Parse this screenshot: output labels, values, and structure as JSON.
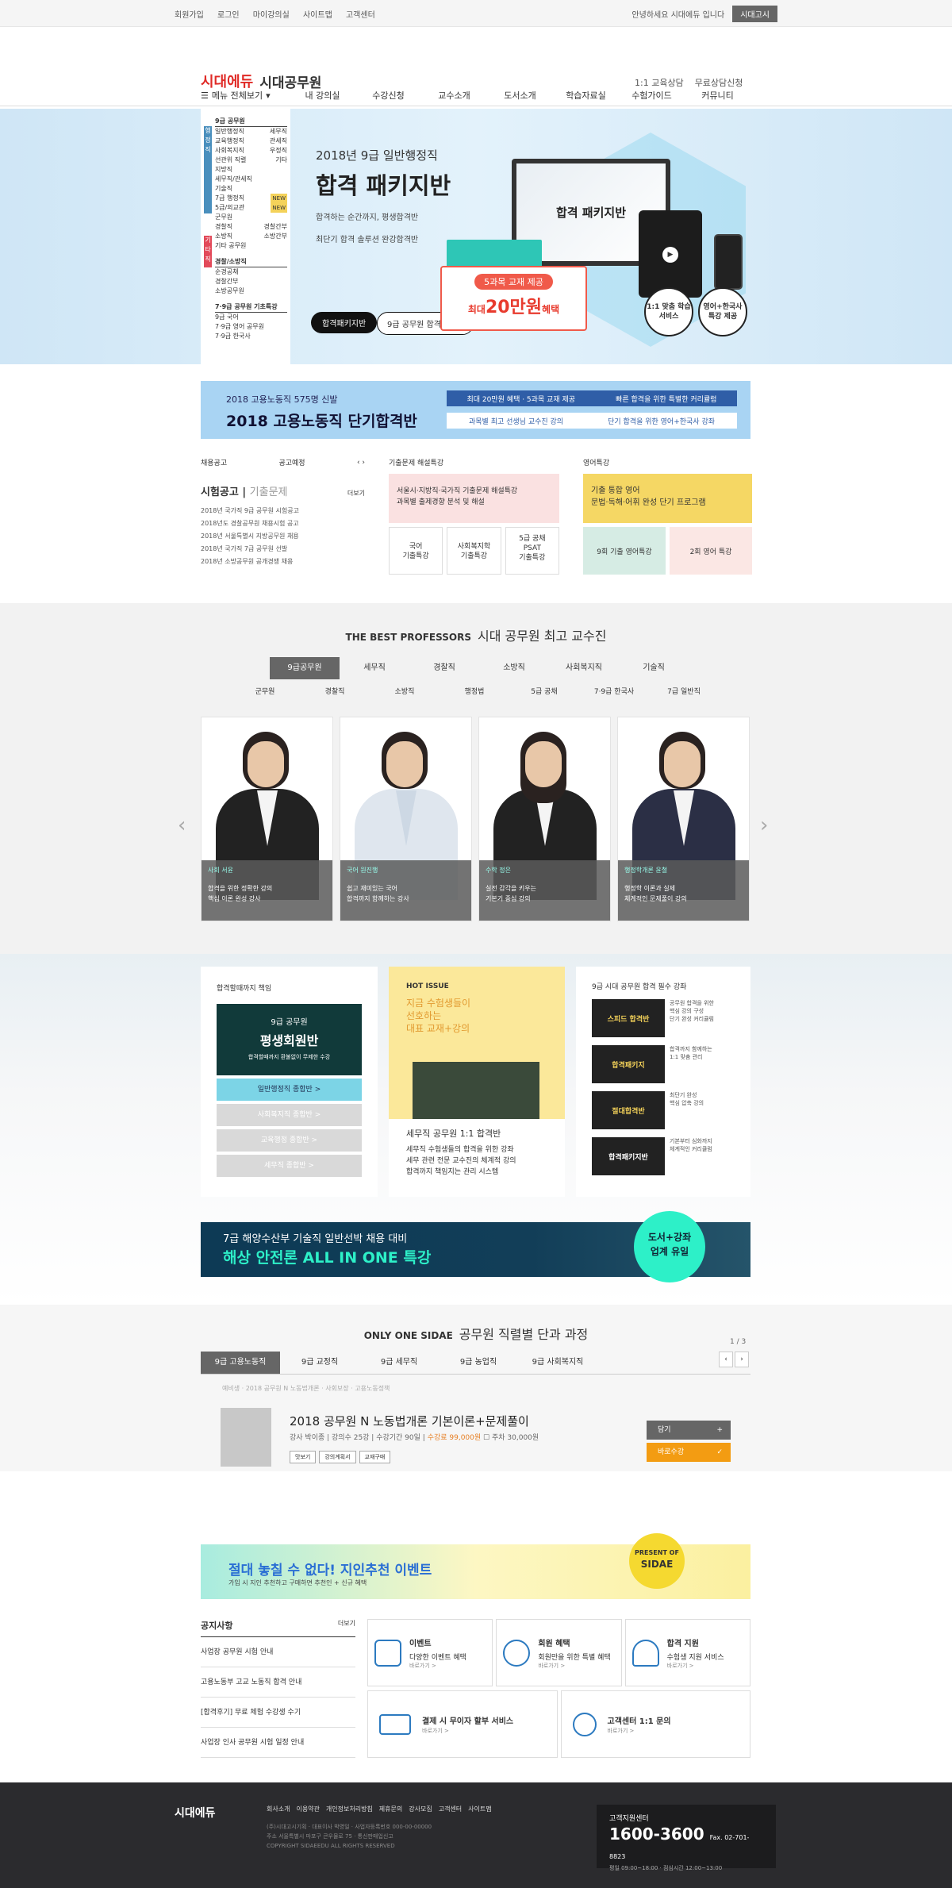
{
  "topbar": {
    "links": [
      "회원가입",
      "로그인",
      "마이강의실",
      "사이트맵",
      "고객센터"
    ],
    "greeting": "안녕하세요 시대에듀 입니다",
    "btn": "시대고시"
  },
  "header": {
    "brand": "시대에듀",
    "site": "시대공무원",
    "r1": "1:1 교육상담",
    "r2": "무료상담신청"
  },
  "gnb": {
    "all": "메뉴 전체보기",
    "items": [
      "내 강의실",
      "수강신청",
      "교수소개",
      "도서소개",
      "학습자료실",
      "수험가이드",
      "커뮤니티"
    ]
  },
  "side": {
    "g1": "9급 공무원",
    "items1": [
      [
        "일반행정직",
        "세무직"
      ],
      [
        "교육행정직",
        "관세직"
      ],
      [
        "사회복지직",
        "우정직"
      ],
      [
        "선관위 직렬",
        "기타"
      ],
      [
        "지방직",
        ""
      ],
      [
        "세무직/관세직",
        ""
      ],
      [
        "기술직",
        ""
      ],
      [
        "7급 행정직",
        "NEW"
      ],
      [
        "5급/외교관",
        "NEW"
      ],
      [
        "군무원",
        ""
      ],
      [
        "경찰직",
        "경찰간부"
      ],
      [
        "소방직",
        "소방간부"
      ],
      [
        "기타 공무원",
        ""
      ]
    ],
    "tab1": "행정직",
    "tab2": "기타직",
    "g2": "경찰/소방직",
    "items2": [
      "순경공채",
      "경찰간부",
      "소방공무원"
    ],
    "g3": "7·9급 공무원 기초특강",
    "items3": [
      "9급 국어",
      "7·9급 영어 공무원",
      "7·9급 한국사"
    ]
  },
  "hero": {
    "sub": "2018년 9급 일반행정직",
    "title": "합격 패키지반",
    "d1": "합격하는 순간까지, 평생합격반",
    "d2": "최단기 합격 솔루션 완강합격반",
    "btn1": "합격패키지반",
    "btn2": "9급 공무원 합격상담반",
    "screen": "합격 패키지반",
    "cp1": "5과목 교재 제공",
    "cp2": "최대",
    "cp3": "20만원",
    "cp4": "혜택",
    "c1": "1:1 맞춤\n학습서비스",
    "c2": "영어+한국사\n특강 제공"
  },
  "bnr2": {
    "l1": "2018 고용노동직 575명 신발",
    "l2": "2018 고용노동직 단기합격반",
    "r1a": "최대 20만원 혜택 · 5과목 교재 제공",
    "r1b": "빠른 합격을 위한 특별한 커리큘럼",
    "r2a": "과목별 최고 선생님 교수진 강의",
    "r2b": "단기 합격을 위한 영어+한국사 강좌"
  },
  "exam": {
    "t1": "채용공고",
    "t2": "공고예정",
    "title": "시험공고",
    "title2": "기출문제",
    "more": "더보기",
    "items": [
      "2018년 국가직 9급 공무원 시험공고",
      "2018년도 경찰공무원 채용시험 공고",
      "2018년 서울특별시 지방공무원 채용",
      "2018년 국가직 7급 공무원 선발",
      "2018년 소방공무원 공개경쟁 채용"
    ]
  },
  "spcA": {
    "hd": "기출문제 해설특강",
    "box": "서울시·지방직·국가직 기출문제 해설특강\n과목별 출제경향 분석 및 해설",
    "m": [
      "국어\n기출특강",
      "사회복지학\n기출특강",
      "5급 공채\nPSAT\n기출특강"
    ]
  },
  "spcB": {
    "hd": "영어특강",
    "box": "기출 통합 영어\n문법·독해·어휘 완성 단기 프로그램",
    "m": [
      "9회 기출 영어특강",
      "2회 영어 특강"
    ]
  },
  "prof": {
    "en": "THE BEST PROFESSORS",
    "ko": "시대 공무원 최고 교수진",
    "tabs": [
      "9급공무원",
      "세무직",
      "경찰직",
      "소방직",
      "사회복지직",
      "기술직"
    ],
    "tabs2": [
      "군무원",
      "경찰직",
      "소방직",
      "행정법",
      "5급 공채",
      "7·9급 한국사",
      "7급 일반직"
    ],
    "cards": [
      {
        "nm": "사회 서윤",
        "d": "합격을 위한 정확한 강의\n핵심 이론 완성 강사"
      },
      {
        "nm": "국어 원진행",
        "d": "쉽고 재미있는 국어\n합격까지 함께하는 강사"
      },
      {
        "nm": "수학 정은",
        "d": "실전 감각을 키우는\n기본기 중심 강의"
      },
      {
        "nm": "행정학개론 윤철",
        "d": "행정학 이론과 실제\n체계적인 문제풀이 강의"
      }
    ]
  },
  "s5": {
    "c1t": "합격할때까지 책임",
    "pv1": "9급 공무원",
    "pv2": "평생회원반",
    "pv3": "합격할때까지 환불없이 무제한 수강",
    "b": [
      "일반행정직 종합반 >",
      "사회복지직 종합반 >",
      "교육행정 종합반 >",
      "세무직 종합반 >"
    ],
    "ht": "HOT ISSUE",
    "hl": "지금 수험생들이\n선호하는\n대표 교재+강의",
    "low": "세무직 공무원 1:1 합격반",
    "lowd": [
      "세무직 수험생들의 합격을 위한 강좌",
      "세무 관련 전문 교수진의 체계적 강의",
      "합격까지 책임지는 관리 시스템"
    ],
    "c3t": "9급 시대 공무원 합격 필수 강좌",
    "th": [
      "스피드 합격반",
      "합격패키지",
      "절대합격반",
      "합격패키지반"
    ],
    "tx": [
      "공무원 합격을 위한\n핵심 강의 구성\n단기 완성 커리큘럼",
      "합격까지 함께하는\n1:1 맞춤 관리",
      "최단기 완성\n핵심 압축 강의",
      "기본부터 심화까지\n체계적인 커리큘럼"
    ],
    "ship1": "7급 해양수산부 기술직 일반선박 채용 대비",
    "ship2": "해상 안전론 ALL IN ONE 특강",
    "shipc": "도서+강좌\n업계 유일"
  },
  "courses": {
    "en": "ONLY ONE SIDAE",
    "ko": "공무원 직렬별 단과 과정",
    "page": "1 / 3",
    "tabs": [
      "9급 고용노동직",
      "9급 교정직",
      "9급 세무직",
      "9급 농업직",
      "9급 사회복지직"
    ],
    "sub": "예비생 · 2018 공무원 N 노동법개론 · 사회보장 · 고용노동정책",
    "title": "2018 공무원 N 노동법개론 기본이론+문제풀이",
    "info": "강사 박이종  |  강의수 25강  |  수강기간 90일  |",
    "price": "수강료 99,000원",
    "stv": "주차 30,000원",
    "b": [
      "맛보기",
      "강의계획서",
      "교재구매"
    ],
    "btn1": "담기",
    "btn2": "바로수강"
  },
  "event": {
    "e1": "절대 놓칠 수 없다! 지인추천 이벤트",
    "e2": "가입 시 지인 추천하고 구매하면 추천인 + 신규 혜택",
    "b1": "PRESENT OF",
    "b2": "SIDAE"
  },
  "notice": {
    "hd": "공지사항",
    "more": "더보기",
    "items": [
      "사업장 공무원 시험 안내",
      "고용노동부 고교 노동직 합격 안내",
      "[합격후기] 무료 체험 수강생 수기",
      "사업장 인사 공무원 시험 일정 안내"
    ]
  },
  "svc": [
    {
      "t": "이벤트",
      "d": "다양한 이벤트 혜택",
      "m": "바로가기 >"
    },
    {
      "t": "회원 혜택",
      "d": "회원만을 위한 특별 혜택",
      "m": "바로가기 >"
    },
    {
      "t": "합격 지원",
      "d": "수험생 지원 서비스",
      "m": "바로가기 >"
    }
  ],
  "svc2": [
    {
      "t": "결제 시 무이자 할부 서비스",
      "m": "바로가기 >"
    },
    {
      "t": "고객센터 1:1 문의",
      "m": "바로가기 >"
    }
  ],
  "footer": {
    "logo": "시대에듀",
    "links": [
      "회사소개",
      "이용약관",
      "개인정보처리방침",
      "제휴문의",
      "강사모집",
      "고객센터",
      "사이트맵"
    ],
    "info": "(주)시대고시기획 · 대표이사 박영일 · 사업자등록번호 000-00-00000\n주소 서울특별시 마포구 큰우물로 75 · 통신판매업신고\nCOPYRIGHT SIDAEEDU ALL RIGHTS RESERVED",
    "csa": "고객지원센터",
    "csn": "1600-3600",
    "fax": "Fax. 02-701-8823",
    "hours": "평일 09:00~18:00 · 점심시간 12:00~13:00"
  }
}
